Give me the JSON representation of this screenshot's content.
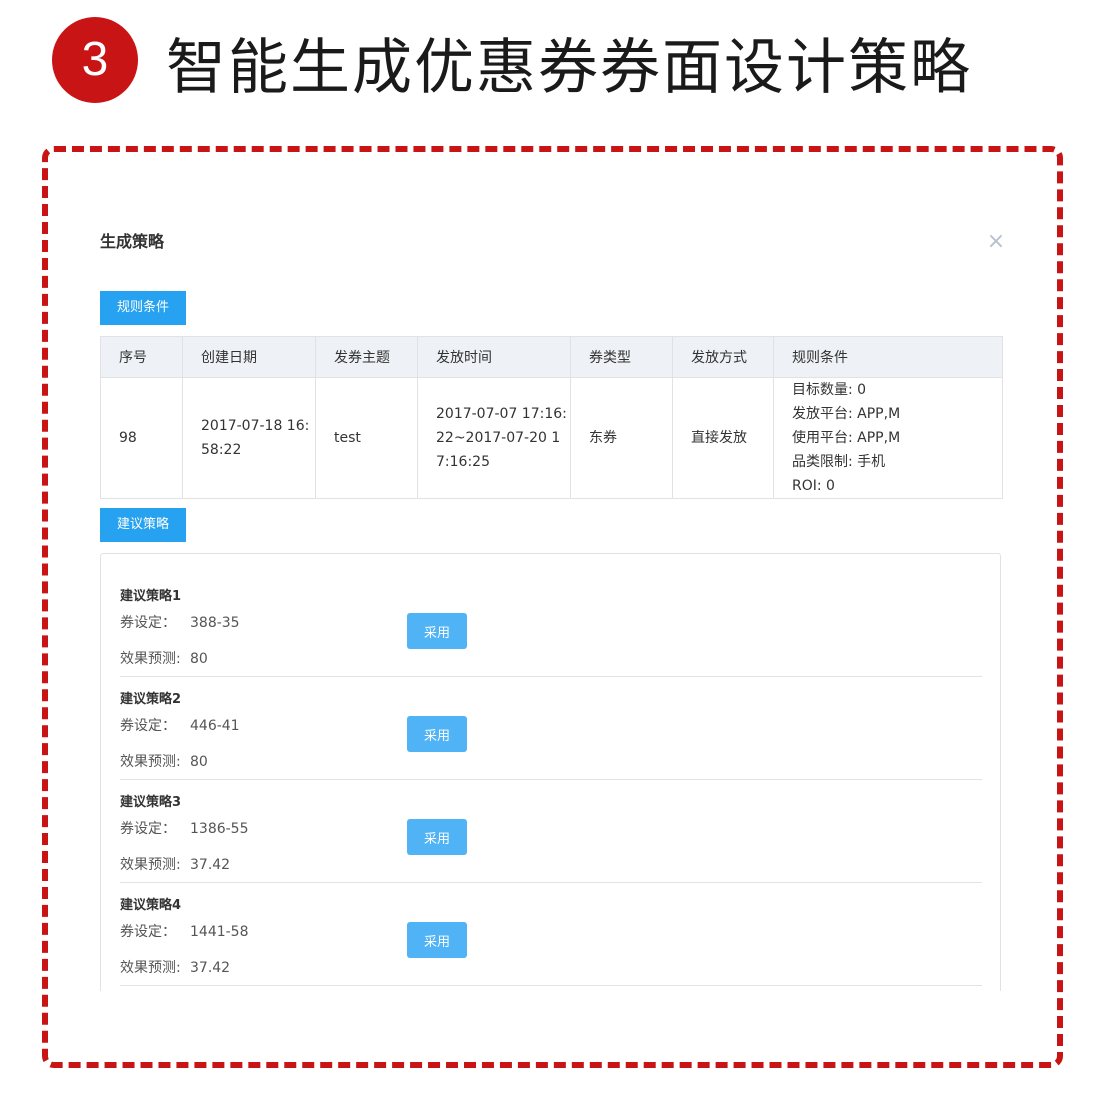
{
  "header": {
    "step_number": "3",
    "title": "智能生成优惠券券面设计策略"
  },
  "dialog": {
    "title": "生成策略",
    "close_icon": "×"
  },
  "rules_section": {
    "tag": "规则条件",
    "columns": [
      "序号",
      "创建日期",
      "发券主题",
      "发放时间",
      "券类型",
      "发放方式",
      "规则条件"
    ],
    "row": {
      "id": "98",
      "created": "2017-07-18 16:58:22",
      "theme": "test",
      "issue_time": "2017-07-07 17:16:22~2017-07-20 17:16:25",
      "coupon_type": "东券",
      "issue_method": "直接发放",
      "rules": [
        "目标数量: 0",
        "发放平台: APP,M",
        "使用平台: APP,M",
        "品类限制: 手机",
        "ROI: 0"
      ]
    }
  },
  "suggest_section": {
    "tag": "建议策略",
    "coupon_label": "券设定：",
    "effect_label": "效果预测:",
    "adopt_label": "采用",
    "strategies": [
      {
        "name": "建议策略1",
        "coupon": "388-35",
        "effect": "80"
      },
      {
        "name": "建议策略2",
        "coupon": "446-41",
        "effect": "80"
      },
      {
        "name": "建议策略3",
        "coupon": "1386-55",
        "effect": "37.42"
      },
      {
        "name": "建议策略4",
        "coupon": "1441-58",
        "effect": "37.42"
      }
    ]
  },
  "colors": {
    "accent_red": "#c81414",
    "tag_blue": "#26a2f0",
    "button_blue": "#4fb3f5"
  }
}
